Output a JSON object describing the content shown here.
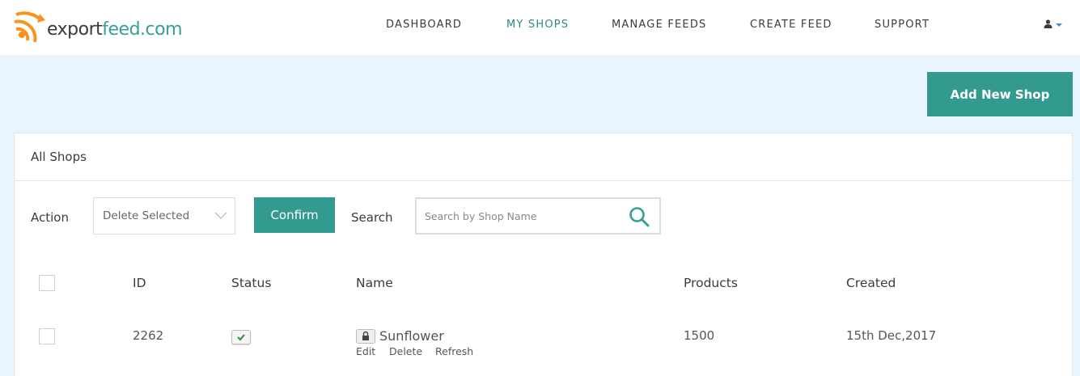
{
  "brand": {
    "name_part1": "export",
    "name_part2": "feed.com"
  },
  "nav": {
    "items": [
      {
        "label": "DASHBOARD"
      },
      {
        "label": "MY SHOPS"
      },
      {
        "label": "MANAGE FEEDS"
      },
      {
        "label": "CREATE FEED"
      },
      {
        "label": "SUPPORT"
      }
    ],
    "active_index": 1
  },
  "toolbar": {
    "add_shop_label": "Add New Shop"
  },
  "panel": {
    "title": "All Shops",
    "action_label": "Action",
    "action_value": "Delete Selected",
    "confirm_label": "Confirm",
    "search_label": "Search",
    "search_placeholder": "Search by Shop Name"
  },
  "table": {
    "headers": [
      "ID",
      "Status",
      "Name",
      "Products",
      "Created"
    ],
    "rows": [
      {
        "id": "2262",
        "status": "active",
        "name": "Sunflower",
        "products": "1500",
        "created": "15th Dec,2017",
        "actions": [
          "Edit",
          "Delete",
          "Refresh"
        ]
      }
    ]
  },
  "colors": {
    "accent": "#339a90",
    "brand_orange": "#f7941d",
    "background": "#eaf4fd",
    "nav_active": "#2f8b81"
  },
  "icons": [
    "logo-signal-icon",
    "user-icon",
    "caret-down-icon",
    "chevron-down-icon",
    "search-icon",
    "checkmark-icon",
    "lock-icon"
  ]
}
